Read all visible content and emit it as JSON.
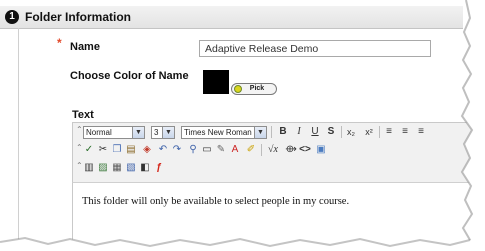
{
  "section": {
    "step_number": "1",
    "title": "Folder Information"
  },
  "form": {
    "required_mark": "*",
    "name_label": "Name",
    "name_value": "Adaptive Release Demo",
    "color_label": "Choose Color of Name",
    "color_value": "#000000",
    "pick_button": "Pick",
    "text_label": "Text"
  },
  "editor": {
    "toolbar": {
      "style_select": "Normal",
      "size_select": "3",
      "font_select": "Times New Roman",
      "bold": "B",
      "italic": "I",
      "underline": "U",
      "strike": "S",
      "subscript": "x₂",
      "superscript": "x²"
    },
    "content": "This folder will only be available to select people in my course."
  }
}
